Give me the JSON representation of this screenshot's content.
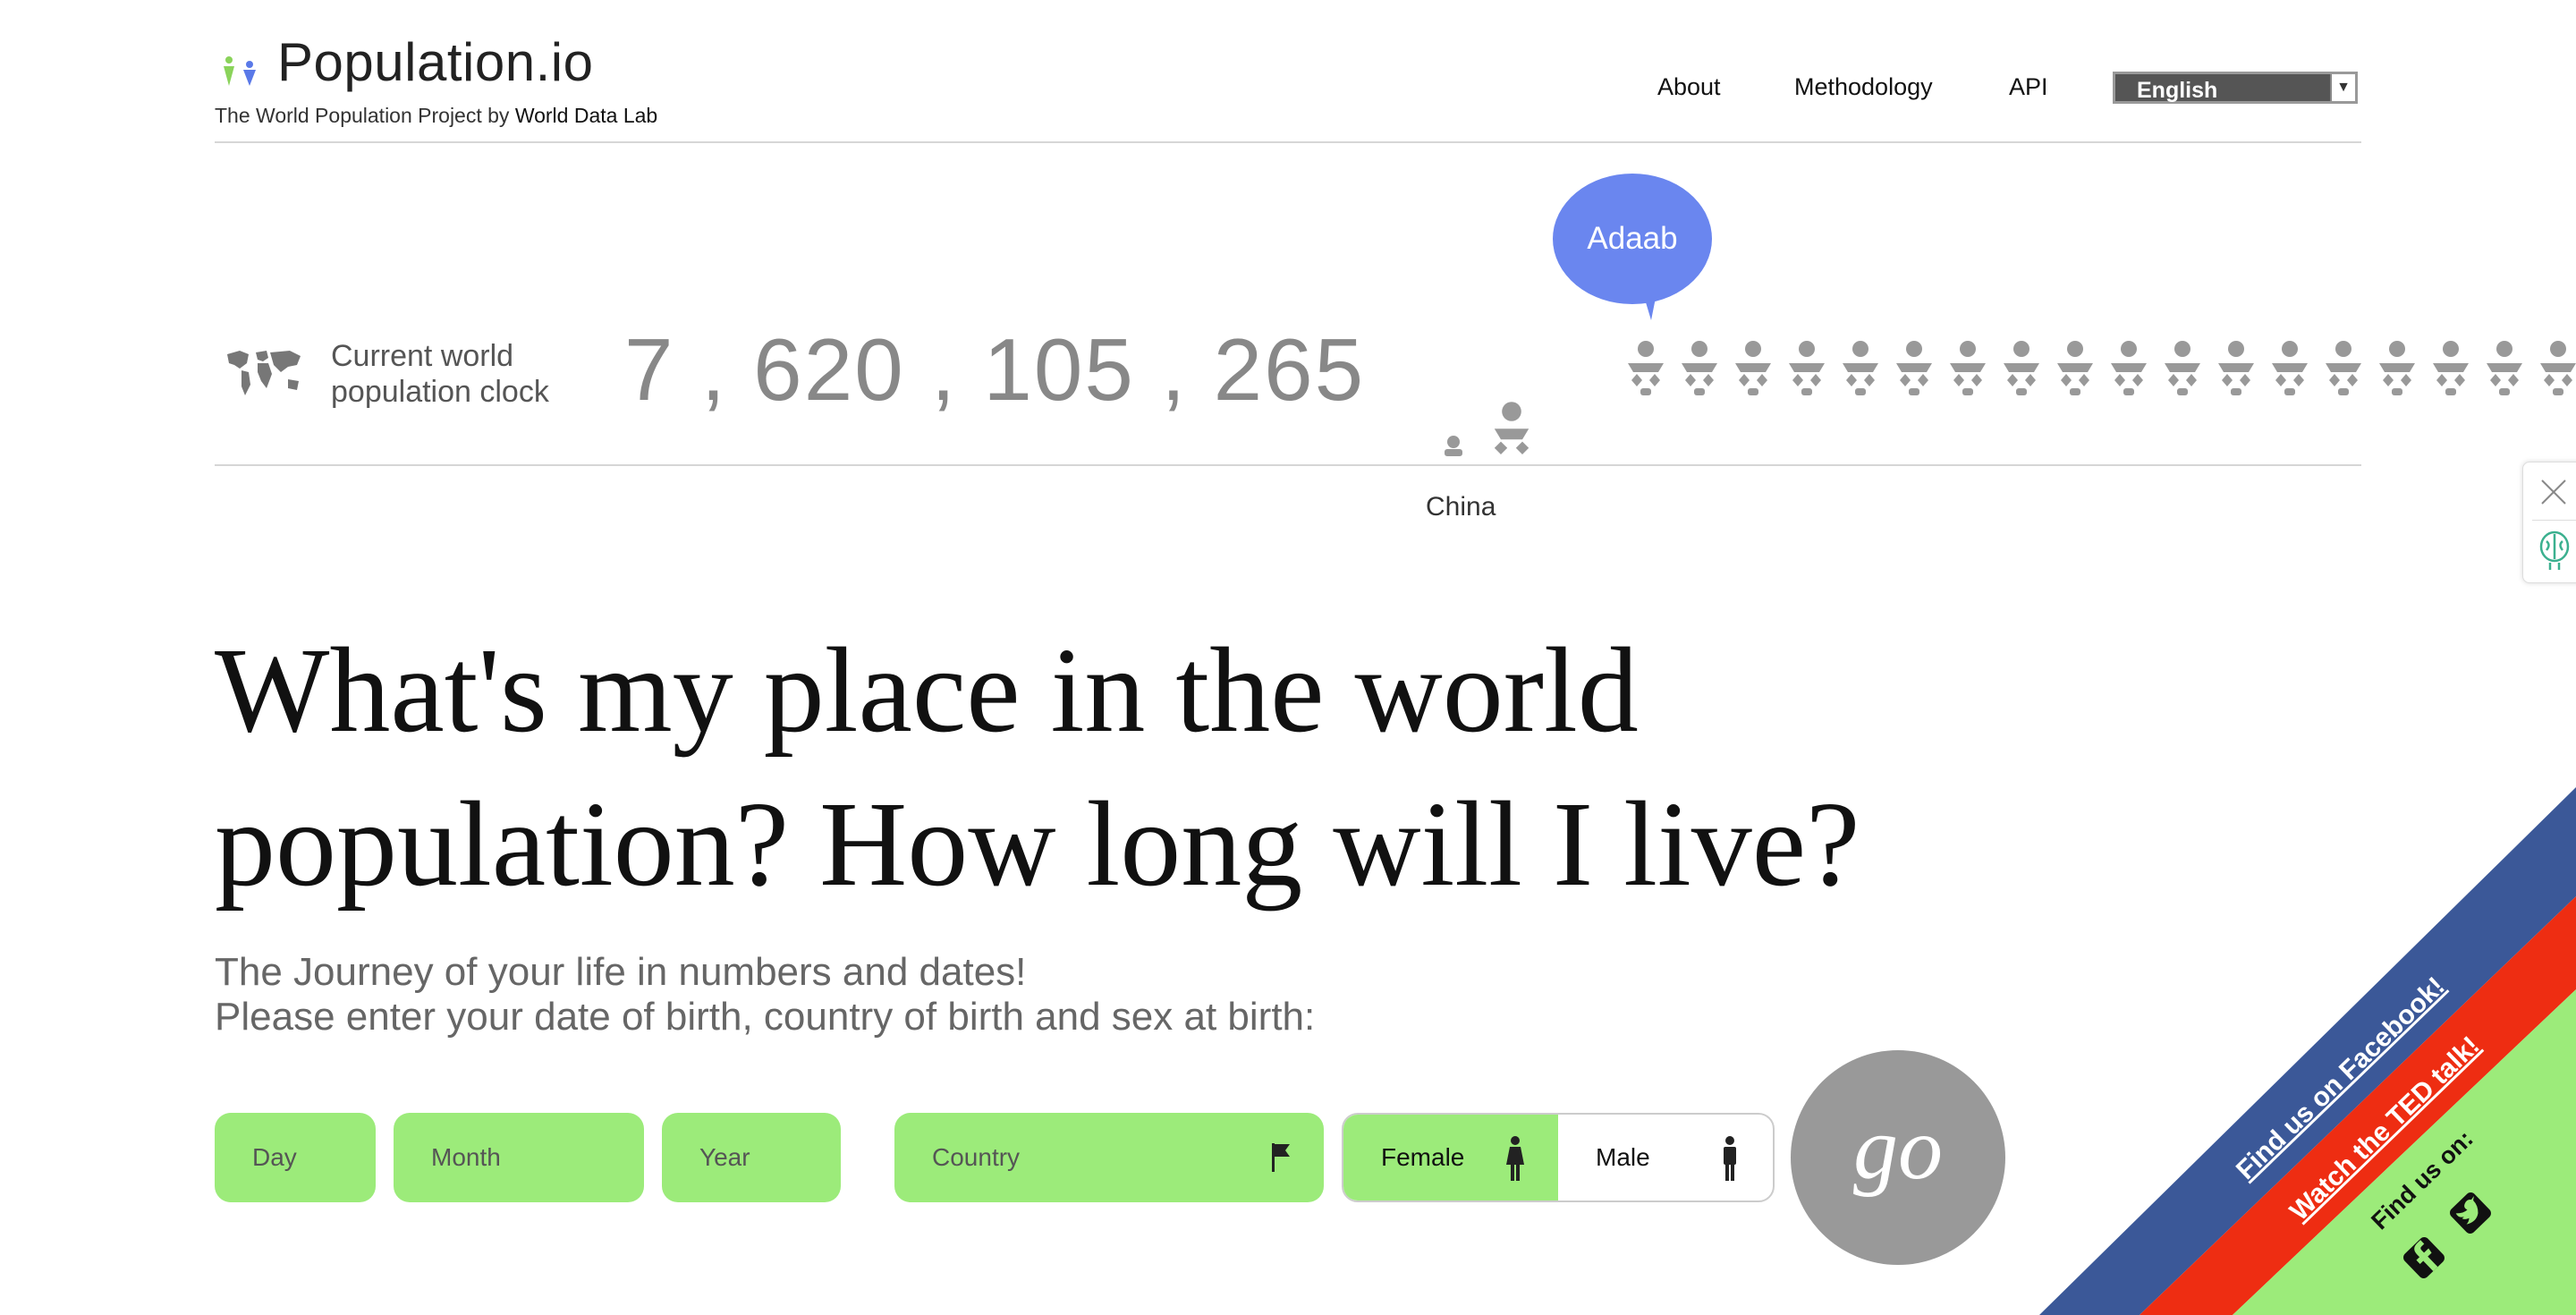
{
  "header": {
    "logo_text": "Population.io",
    "tagline_prefix": "The World Population Project by ",
    "tagline_org": "World Data Lab",
    "nav": [
      "About",
      "Methodology",
      "API"
    ],
    "language": "English"
  },
  "clock": {
    "label_line1": "Current world",
    "label_line2": "population clock",
    "value": "7,620,105,26",
    "greeting": "Adaab",
    "country": "China"
  },
  "hero": {
    "headline_line1": "What's my place in the world",
    "headline_line2": "population? How long will I live?",
    "sub_line1": "The Journey of your life in numbers and dates!",
    "sub_line2": "Please enter your date of birth, country of birth and sex at birth:"
  },
  "form": {
    "day_placeholder": "Day",
    "month_placeholder": "Month",
    "year_placeholder": "Year",
    "country_placeholder": "Country",
    "female_label": "Female",
    "male_label": "Male",
    "go_label": "go"
  },
  "ribbons": {
    "facebook": "Find us on Facebook!",
    "ted": "Watch the TED talk!",
    "social": "Find us on:"
  },
  "colors": {
    "accent_green": "#9ceb7a",
    "bubble_blue": "#6a86ef",
    "ribbon_blue": "#3b5898",
    "ribbon_red": "#ee2d12"
  },
  "icons": [
    "people-logo-icon",
    "world-map-icon",
    "baby-icon",
    "flag-icon",
    "female-icon",
    "male-icon",
    "close-icon",
    "brain-icon",
    "facebook-icon",
    "twitter-icon"
  ]
}
